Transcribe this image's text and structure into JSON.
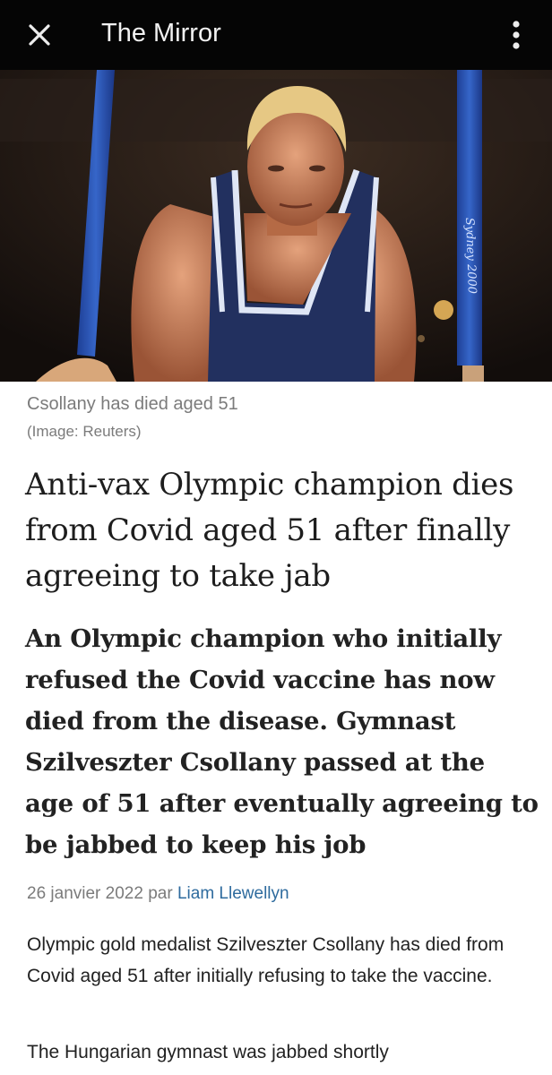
{
  "app_bar": {
    "title": "The Mirror",
    "close_icon": "close-icon",
    "menu_icon": "more-vert-icon"
  },
  "hero": {
    "ring_strap_text": "Sydney 2000"
  },
  "caption": {
    "text": "Csollany has died aged 51",
    "credit": "(Image: Reuters)"
  },
  "article": {
    "headline": "Anti-vax Olympic champion dies from Covid aged 51 after finally agreeing to take jab",
    "standfirst": "An Olympic champion who initially refused the Covid vaccine has now died from the disease. Gymnast Szilveszter Csollany passed at the age of 51 after eventually agreeing to be jabbed to keep his job",
    "date": "26 janvier 2022",
    "by_word": "par",
    "author": "Liam Llewellyn",
    "paragraphs": [
      "Olympic gold medalist Szilveszter Csollany has died from Covid aged 51 after initially refusing to take the vaccine.",
      "The Hungarian gymnast was jabbed shortly"
    ]
  },
  "colors": {
    "app_bar_bg": "#050505",
    "caption_text": "#7b7b7b",
    "author_link": "#2e6b9e"
  }
}
